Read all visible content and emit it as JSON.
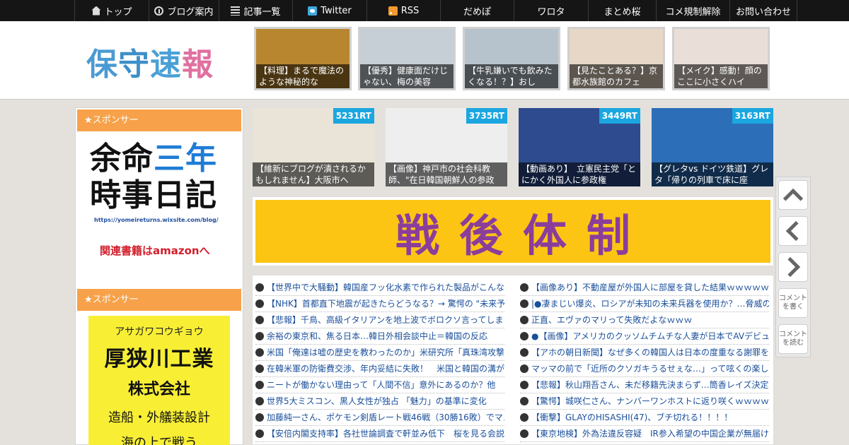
{
  "nav": {
    "items": [
      {
        "label": "トップ",
        "icon": "home-icon",
        "width": 105
      },
      {
        "label": "ブログ案内",
        "icon": "info-icon",
        "width": 99
      },
      {
        "label": "記事一覧",
        "icon": "list-icon",
        "width": 104
      },
      {
        "label": "Twitter",
        "icon": "twitter-icon",
        "width": 105
      },
      {
        "label": "RSS",
        "icon": "rss-icon",
        "width": 104
      },
      {
        "label": "だめぽ",
        "icon": "",
        "width": 104
      },
      {
        "label": "ワロタ",
        "icon": "",
        "width": 105
      },
      {
        "label": "まとめ桜",
        "icon": "",
        "width": 96
      },
      {
        "label": "コメ規制解除",
        "icon": "",
        "width": 104
      },
      {
        "label": "お問い合わせ",
        "icon": "",
        "width": 95
      }
    ]
  },
  "header": {
    "logo": [
      "保",
      "守",
      "速",
      "報"
    ],
    "thumbs": [
      {
        "caption": "【料理】まるで魔法のような神秘的な",
        "color": "#b8862e"
      },
      {
        "caption": "【優秀】健康面だけじゃない、梅の美容",
        "color": "#c7cfd6"
      },
      {
        "caption": "【牛乳嫌いでも飲みたくなる！？】おし",
        "color": "#b6c3cc"
      },
      {
        "caption": "【見たことある？】京都水族館のカフェ",
        "color": "#e7d7c6"
      },
      {
        "caption": "【メイク】感動！顔のここに小さくハイ",
        "color": "#eadfd8"
      }
    ]
  },
  "sidebar": {
    "sponsor1": "★スポンサー",
    "sponsor2": "★スポンサー",
    "ad1": {
      "line1": "余命",
      "line1_blue": "三年",
      "line2": "時事日記",
      "url": "https://yomeireturns.wixsite.com/blog/",
      "amazon": "関連書籍はamazonへ"
    },
    "ad2": {
      "kana": "アサガワコウギョウ",
      "name": "厚狭川工業",
      "kk": "株式会社",
      "service": "造船・外艤装設計",
      "more": "海の上で戦う"
    }
  },
  "rt": [
    {
      "count": "5231RT",
      "caption": "【維新にブログが潰されるかもしれません】大阪市へ",
      "color": "#e9e3d8"
    },
    {
      "count": "3735RT",
      "caption": "【画像】神戸市の社会科教師、\"在日韓国朝鮮人の参政",
      "color": "#eeeeee"
    },
    {
      "count": "3449RT",
      "caption": "【動画あり】　立憲民主党「とにかく外国人に参政権",
      "color": "#2e4b8f"
    },
    {
      "count": "3163RT",
      "caption": "【グレタvs ドイツ鉄道】グレタ「帰りの列車で床に座",
      "color": "#2c6fb8"
    }
  ],
  "banner": {
    "text": "戦後体制"
  },
  "links": {
    "left": [
      "【世界中で大騒動】韓国産フッ化水素で作られた製品がこんな",
      "【NHK】首都直下地震が起きたらどうなる？→ 驚愕の \"未来予",
      "【悲報】千鳥、高級イタリアンを地上波でボロクソ言ってしま",
      "余裕の東京和、焦る日本…韓日外相会談中止＝韓国の反応",
      "米国「俺達は嘘の歴史を教わったのか」米研究所「真珠湾攻撃",
      "在韓米軍の防衛費交渉、年内妥結に失敗！　米国と韓国の溝が",
      "ニートが働かない理由って「人間不信」意外にあるのか？他",
      "世界5大ミスコン、黒人女性が独占 「魅力」の基準に変化",
      "加藤純一さん、ポケモン剣盾レート戦46戦（30勝16敗）でマス",
      "【安倍内閣支持率】各社世論調査で軒並み低下　桜を見る会説"
    ],
    "right": [
      "【画像あり】不動産屋が外国人に部屋を貸した結果ｗｗｗｗｗ",
      "|●凄まじい爆炎、ロシアが未知の未来兵器を使用か？…脅威の",
      "正直、エヴァのマリって失敗だよなｗｗｗ",
      "●【画像】アメリカのクッソムチムチな人妻が日本でAVデビュ",
      "【アホの朝日新聞】なぜ多くの韓国人は日本の度重なる謝罪を",
      "マッマの前で「近所のクソガキうるせぇな…」って呟くの楽し",
      "【悲報】秋山翔吾さん、未だ移籍先決まらず…筒香レイズ決定",
      "【驚愕】城咲仁さん、ナンバーワンホストに返り咲くｗｗｗｗ",
      "【衝撃】GLAYのHISASHI(47)、ブチ切れる！！！！",
      "【東京地検】外為法違反容疑　IR参入希望の中国企業が無届け"
    ]
  },
  "floatbar": {
    "comment_write": "コメントを書く",
    "comment_read": "コメントを読む"
  }
}
